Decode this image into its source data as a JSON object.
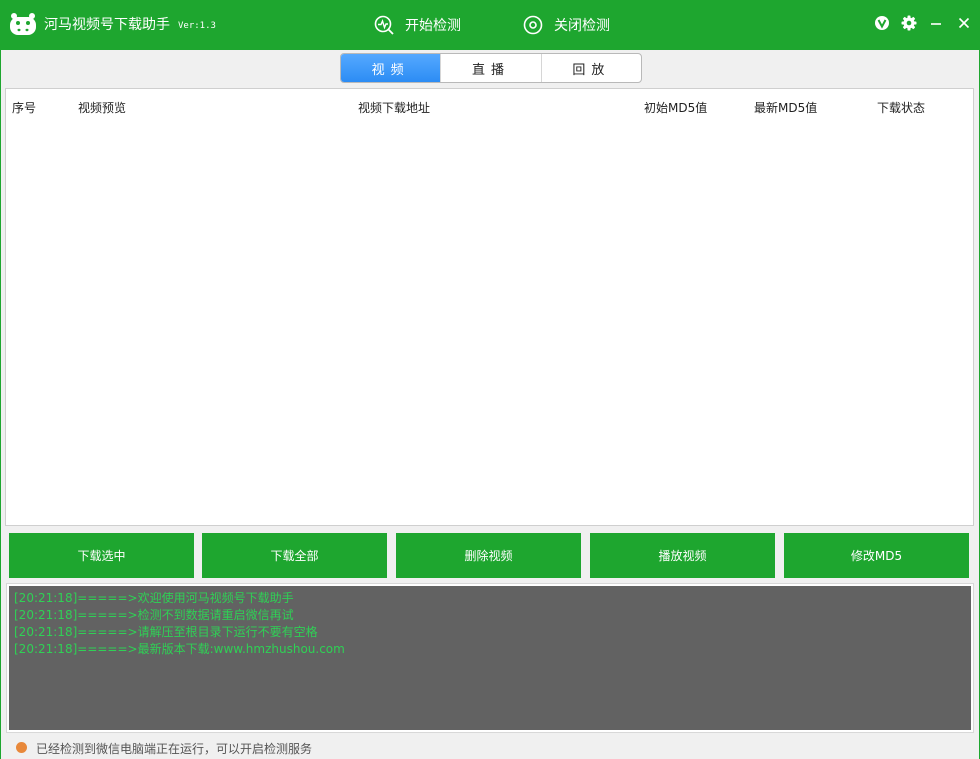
{
  "app": {
    "title": "河马视频号下载助手",
    "version": "Ver:1.3"
  },
  "top_actions": {
    "start": "开始检测",
    "stop": "关闭检测"
  },
  "tabs": [
    {
      "label": "视频",
      "active": true
    },
    {
      "label": "直播",
      "active": false
    },
    {
      "label": "回放",
      "active": false
    }
  ],
  "table": {
    "columns": [
      "序号",
      "视频预览",
      "视频下载地址",
      "初始MD5值",
      "最新MD5值",
      "下载状态"
    ],
    "rows": []
  },
  "buttons": [
    "下载选中",
    "下载全部",
    "删除视频",
    "播放视频",
    "修改MD5"
  ],
  "log": [
    "[20:21:18]=====>欢迎使用河马视频号下载助手",
    "[20:21:18]=====>检测不到数据请重启微信再试",
    "[20:21:18]=====>请解压至根目录下运行不要有空格",
    "[20:21:18]=====>最新版本下载:www.hmzhushou.com"
  ],
  "status": {
    "text": "已经检测到微信电脑端正在运行，可以开启检测服务"
  },
  "colors": {
    "brand_green": "#1ea62f",
    "tab_active_blue": "#2c8cf4",
    "log_background": "#626262",
    "log_text": "#2fd155",
    "status_dot": "#e8883a"
  },
  "icons": {
    "logo": "hippo-logo-icon",
    "start": "monitor-wave-icon",
    "stop": "stop-circle-icon",
    "vip": "v-badge-icon",
    "settings": "gear-icon",
    "minimize": "minimize-icon",
    "close": "close-icon"
  }
}
